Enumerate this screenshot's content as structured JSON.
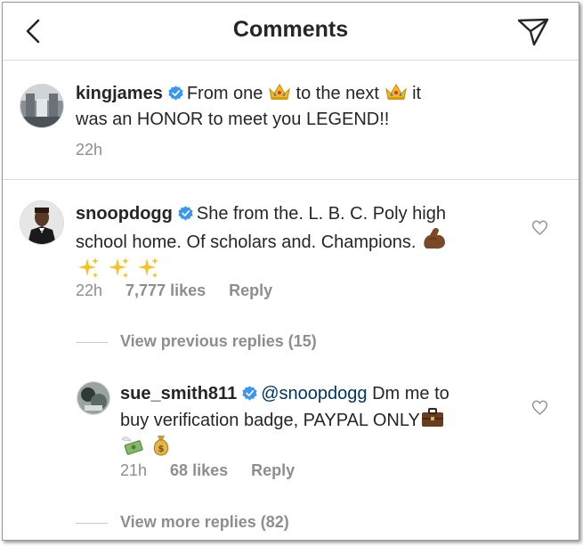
{
  "header": {
    "title": "Comments"
  },
  "caption": {
    "username": "kingjames",
    "text_part1": "From one",
    "text_part2": "to the next",
    "text_part3": "it",
    "text_line2": "was an HONOR to meet you LEGEND!!",
    "time": "22h"
  },
  "comment": {
    "username": "snoopdogg",
    "text_line1": "She from the. L.  B. C.  Poly high",
    "text_line2": "school home. Of scholars and. Champions.",
    "time": "22h",
    "likes": "7,777 likes",
    "reply_label": "Reply"
  },
  "view_previous": "View previous replies (15)",
  "reply": {
    "username": "sue_smith811",
    "mention": "@snoopdogg",
    "text_line1": "Dm me to",
    "text_line2": "buy verification badge, PAYPAL ONLY",
    "time": "21h",
    "likes": "68 likes",
    "reply_label": "Reply"
  },
  "view_more": "View more replies (82)",
  "colors": {
    "text": "#262626",
    "secondary": "#8e8e8e",
    "verified": "#3897f0",
    "mention": "#003569",
    "divider": "#dbdbdb"
  },
  "icons": [
    "back-arrow-icon",
    "direct-send-icon",
    "verified-badge-icon",
    "crown-emoji",
    "flexed-biceps-emoji",
    "sparkles-emoji",
    "briefcase-emoji",
    "money-with-wings-emoji",
    "money-bag-emoji",
    "heart-icon"
  ]
}
